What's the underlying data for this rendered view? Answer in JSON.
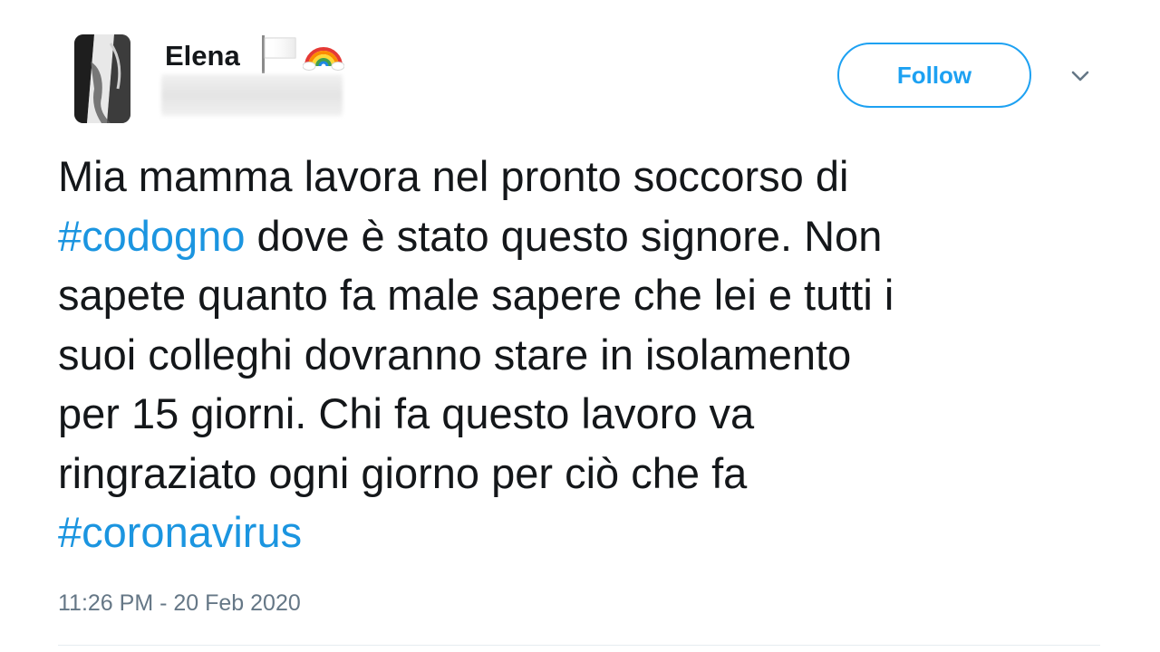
{
  "user": {
    "name": "Elena",
    "emojis": [
      "white-flag-icon",
      "rainbow-icon"
    ]
  },
  "follow_label": "Follow",
  "tweet": {
    "lines": [
      {
        "segments": [
          {
            "text": "Mia mamma lavora nel pronto soccorso di",
            "hashtag": false
          }
        ]
      },
      {
        "segments": [
          {
            "text": "#codogno",
            "hashtag": true
          },
          {
            "text": " dove è stato questo signore. Non",
            "hashtag": false
          }
        ]
      },
      {
        "segments": [
          {
            "text": "sapete quanto fa male sapere che lei e tutti i",
            "hashtag": false
          }
        ]
      },
      {
        "segments": [
          {
            "text": "suoi colleghi dovranno stare in isolamento",
            "hashtag": false
          }
        ]
      },
      {
        "segments": [
          {
            "text": "per 15 giorni. Chi fa questo lavoro va",
            "hashtag": false
          }
        ]
      },
      {
        "segments": [
          {
            "text": "ringraziato ogni giorno per ciò che fa",
            "hashtag": false
          }
        ]
      },
      {
        "segments": [
          {
            "text": "#coronavirus",
            "hashtag": true
          }
        ]
      }
    ],
    "timestamp": "11:26 PM - 20 Feb 2020"
  },
  "colors": {
    "accent": "#1da1f2",
    "hashtag": "#1b95e0",
    "text": "#14171a",
    "muted": "#657786"
  }
}
